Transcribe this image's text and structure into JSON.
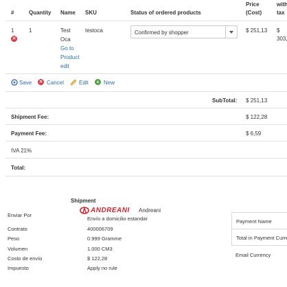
{
  "table": {
    "headers": {
      "num": "#",
      "quantity": "Quantity",
      "name": "Name",
      "sku": "SKU",
      "status": "Status of ordered products",
      "price_line1": "Price",
      "price_line2": "(Cost)",
      "with_line1": "with",
      "with_line2": "tax"
    },
    "row": {
      "num": "1",
      "quantity": "1",
      "name_line1": "Test",
      "name_line2": "Oca",
      "goto_line1": "Go to",
      "goto_line2": "Product",
      "goto_line3": "edit",
      "sku": "testoca",
      "status": "Confirmed by shopper",
      "price": "$ 251,13",
      "with_tax_line1": "$",
      "with_tax_line2": "303,"
    }
  },
  "actions": {
    "save": "Save",
    "cancel": "Cancel",
    "edit": "Edit",
    "new": "New"
  },
  "totals": {
    "subtotal_label": "SubTotal:",
    "subtotal_value": "$ 251,13",
    "shipment_fee_label": "Shipment Fee:",
    "shipment_fee_value": "$ 122,28",
    "payment_fee_label": "Payment Fee:",
    "payment_fee_value": "$ 6,59",
    "iva_label": "IVA 21%",
    "total_label": "Total:"
  },
  "shipment": {
    "heading": "Shipment",
    "rows": [
      {
        "label": "Enviar Por",
        "value": "Envío a domicilio estandar"
      },
      {
        "label": "Contrato",
        "value": "400006709"
      },
      {
        "label": "Peso",
        "value": "0.999 Gramme"
      },
      {
        "label": "Volumen",
        "value": "1.000 CM3"
      },
      {
        "label": "Costo de envío",
        "value": "$ 122,28"
      },
      {
        "label": "Impuesto",
        "value": "Apply no rule"
      }
    ],
    "carrier_logo_text": "ANDREANI",
    "carrier_name": "Andreani"
  },
  "payment": {
    "name_label": "Payment Name",
    "total_label": "Total in Payment Curre",
    "currency_label": "Email Currency"
  },
  "colors": {
    "link": "#2a6fb5",
    "andreani_red": "#d8232a",
    "cancel_red": "#d9363e",
    "new_green": "#4aa33c"
  }
}
